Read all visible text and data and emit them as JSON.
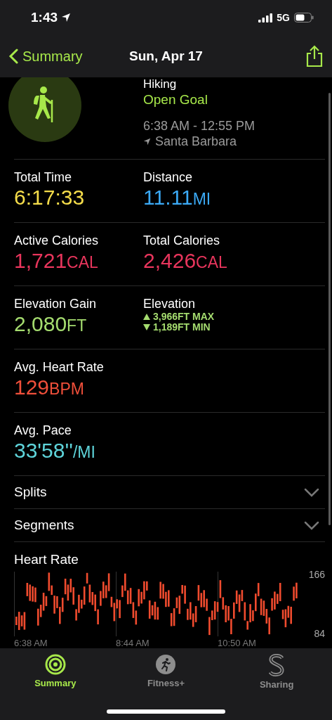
{
  "status_bar": {
    "time": "1:43",
    "network": "5G"
  },
  "nav": {
    "back": "Summary",
    "title": "Sun, Apr 17"
  },
  "workout": {
    "type": "Hiking",
    "goal": "Open Goal",
    "time_range": "6:38 AM - 12:55 PM",
    "location": "Santa Barbara"
  },
  "metric_rows": [
    [
      {
        "kind": "value",
        "label": "Total Time",
        "value": "6:17:33",
        "color": "#f4dc4a"
      },
      {
        "kind": "value",
        "label": "Distance",
        "value": "11.11",
        "unit": "MI",
        "color": "#3ba9f5"
      }
    ],
    [
      {
        "kind": "value",
        "label": "Active Calories",
        "value": "1,721",
        "unit": "CAL",
        "color": "#e8355c"
      },
      {
        "kind": "value",
        "label": "Total Calories",
        "value": "2,426",
        "unit": "CAL",
        "color": "#e8355c"
      }
    ],
    [
      {
        "kind": "value",
        "label": "Elevation Gain",
        "value": "2,080",
        "unit": "FT",
        "color": "#a5dc6f"
      },
      {
        "kind": "range",
        "label": "Elevation",
        "max": "3,966FT MAX",
        "min": "1,189FT MIN",
        "color": "#a5dc6f"
      }
    ],
    [
      {
        "kind": "value",
        "label": "Avg. Heart Rate",
        "value": "129",
        "unit": "BPM",
        "color": "#ef4f3a"
      }
    ],
    [
      {
        "kind": "value",
        "label": "Avg. Pace",
        "value": "33'58''",
        "unit": "/MI",
        "color": "#5ed4da"
      }
    ]
  ],
  "sections": [
    {
      "label": "Splits",
      "expanded": false
    },
    {
      "label": "Segments",
      "expanded": false
    }
  ],
  "heart_rate": {
    "title": "Heart Rate",
    "y_max": "166",
    "y_min": "84",
    "times": [
      "6:38 AM",
      "8:44 AM",
      "10:50 AM"
    ]
  },
  "tabs": [
    {
      "label": "Summary",
      "selected": true
    },
    {
      "label": "Fitness+",
      "selected": false
    },
    {
      "label": "Sharing",
      "selected": false
    }
  ]
}
